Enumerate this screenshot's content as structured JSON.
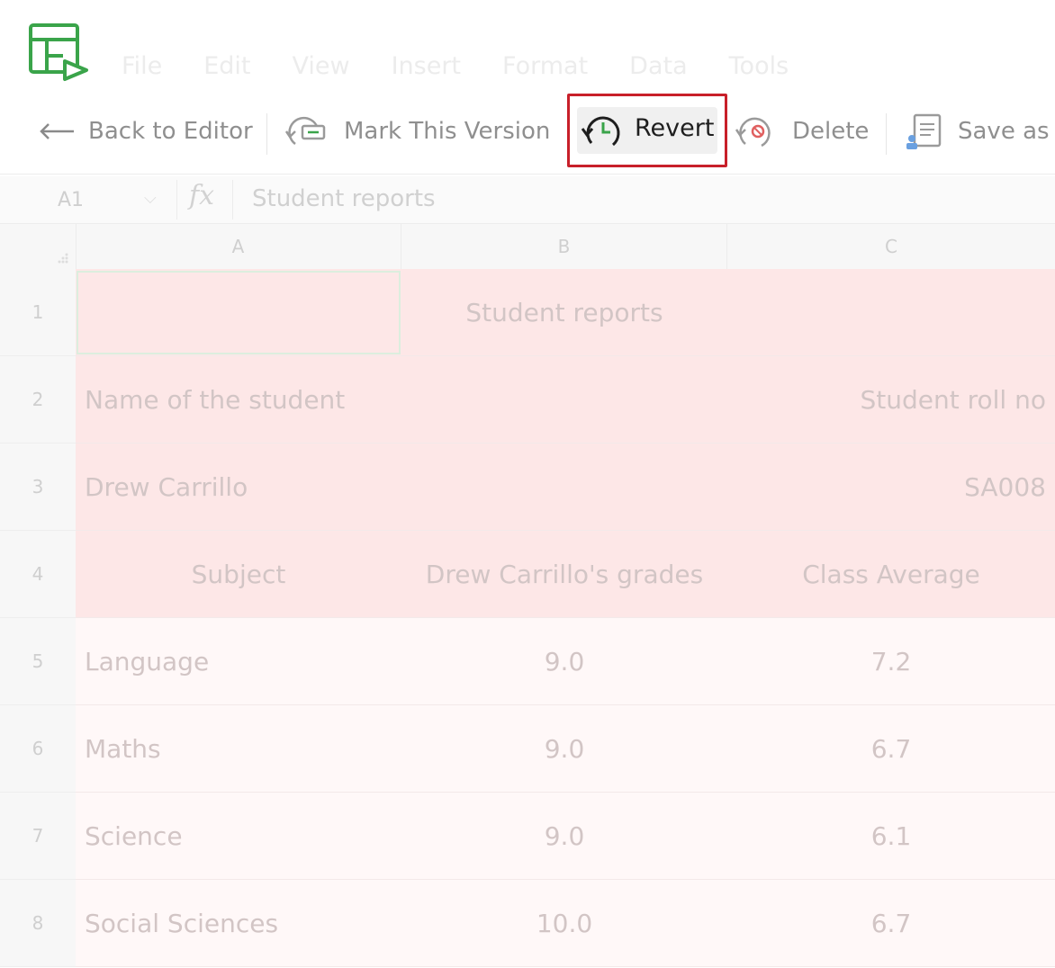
{
  "menu": [
    "File",
    "Edit",
    "View",
    "Insert",
    "Format",
    "Data",
    "Tools"
  ],
  "toolbar": {
    "back_label": "Back to Editor",
    "mark_label": "Mark This Version",
    "revert_label": "Revert",
    "delete_label": "Delete",
    "save_as_label": "Save as"
  },
  "formula_bar": {
    "cell_ref": "A1",
    "fx": "fx",
    "value": "Student reports"
  },
  "columns": [
    "A",
    "B",
    "C"
  ],
  "rows": [
    {
      "num": "1",
      "type": "title",
      "a": "",
      "b": "Student reports",
      "c": ""
    },
    {
      "num": "2",
      "type": "header",
      "a": "Name of the student",
      "b": "",
      "c": "Student roll no"
    },
    {
      "num": "3",
      "type": "header",
      "a": "Drew Carrillo",
      "b": "",
      "c": "SA008"
    },
    {
      "num": "4",
      "type": "header",
      "a": "Subject",
      "b": "Drew Carrillo's grades",
      "c": "Class Average"
    },
    {
      "num": "5",
      "type": "data",
      "a": "Language",
      "b": "9.0",
      "c": "7.2"
    },
    {
      "num": "6",
      "type": "data",
      "a": "Maths",
      "b": "9.0",
      "c": "6.7"
    },
    {
      "num": "7",
      "type": "data",
      "a": "Science",
      "b": "9.0",
      "c": "6.1"
    },
    {
      "num": "8",
      "type": "data",
      "a": "Social Sciences",
      "b": "10.0",
      "c": "6.7"
    }
  ],
  "colors": {
    "highlight_border": "#c8202a",
    "logo_green": "#3aa44a",
    "header_fill": "#fde7e7",
    "data_fill": "#fff8f8"
  }
}
